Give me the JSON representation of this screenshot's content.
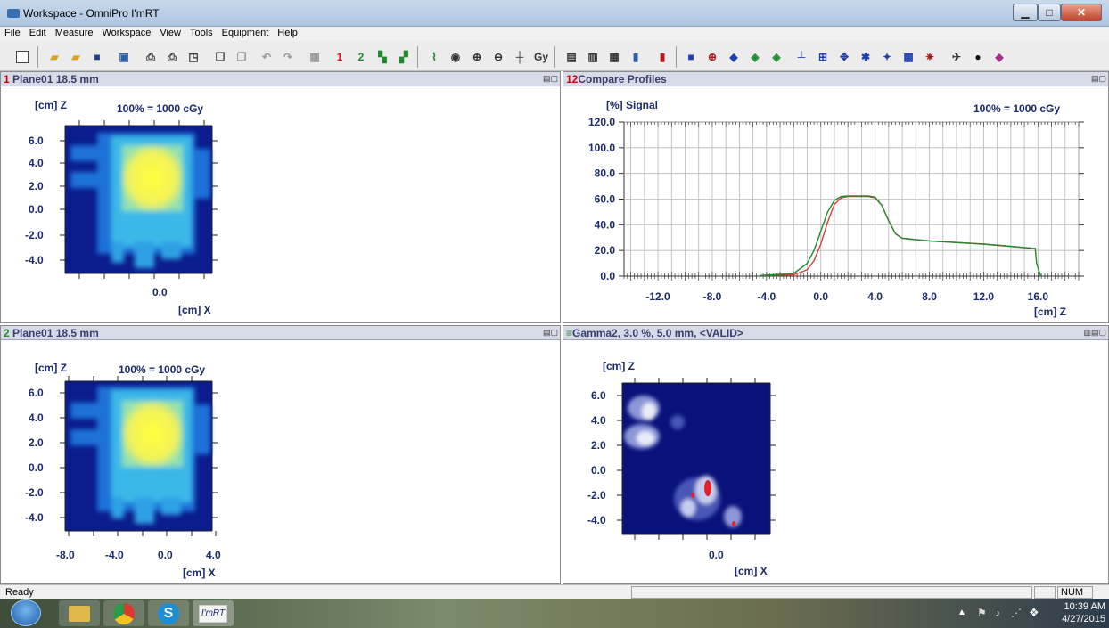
{
  "window": {
    "title": "Workspace - OmniPro I'mRT"
  },
  "menu": [
    "File",
    "Edit",
    "Measure",
    "Workspace",
    "View",
    "Tools",
    "Equipment",
    "Help"
  ],
  "toolbar": {
    "label_1": "1",
    "label_2": "2",
    "label_gy": "Gy"
  },
  "panels": {
    "plane1": {
      "num": "1",
      "title": "Plane01 18.5 mm",
      "z_unit": "[cm] Z",
      "dose_ref": "100% = 1000 cGy",
      "y_ticks": [
        "6.0",
        "4.0",
        "2.0",
        "0.0",
        "-2.0",
        "-4.0"
      ],
      "x_ticks": [
        "0.0"
      ],
      "x_unit": "[cm] X"
    },
    "profiles": {
      "num": "12",
      "title": "Compare Profiles",
      "y_label": "[%] Signal",
      "dose_ref": "100% = 1000 cGy",
      "x_unit": "[cm] Z"
    },
    "plane2": {
      "num": "2",
      "title": "Plane01 18.5 mm",
      "z_unit": "[cm] Z",
      "dose_ref": "100% = 1000 cGy",
      "y_ticks": [
        "6.0",
        "4.0",
        "2.0",
        "0.0",
        "-2.0",
        "-4.0"
      ],
      "x_ticks": [
        "-8.0",
        "-4.0",
        "0.0",
        "4.0"
      ],
      "x_unit": "[cm] X"
    },
    "gamma": {
      "title": "Gamma2,  3.0 %,  5.0 mm,  <VALID>",
      "z_unit": "[cm] Z",
      "y_ticks": [
        "6.0",
        "4.0",
        "2.0",
        "0.0",
        "-2.0",
        "-4.0"
      ],
      "x_ticks": [
        "0.0"
      ],
      "x_unit": "[cm] X"
    }
  },
  "chart_data": {
    "type": "line",
    "title": "",
    "xlabel": "[cm] Z",
    "ylabel": "[%] Signal",
    "xlim": [
      -14.5,
      19.0
    ],
    "ylim": [
      0,
      120
    ],
    "x_ticks": [
      "-12.0",
      "-8.0",
      "-4.0",
      "0.0",
      "4.0",
      "8.0",
      "12.0",
      "16.0"
    ],
    "y_ticks": [
      "120.0",
      "100.0",
      "80.0",
      "60.0",
      "40.0",
      "20.0",
      "0.0"
    ],
    "grid": true,
    "colors": {
      "series_1": "#e23b3b",
      "series_2": "#1f8a2e"
    },
    "series": [
      {
        "color": "#e23b3b",
        "x": [
          -4.5,
          -2.0,
          -1.0,
          -0.5,
          0.0,
          0.5,
          1.0,
          1.5,
          2.0,
          3.5,
          4.0,
          4.5,
          5.0,
          5.5,
          6.0,
          8.0,
          12.0,
          15.8
        ],
        "y": [
          0.5,
          1.0,
          5.0,
          12.0,
          25.0,
          42.0,
          56.0,
          61.0,
          62.0,
          62.0,
          61.0,
          55.0,
          43.0,
          33.0,
          29.5,
          27.5,
          25.0,
          21.5
        ]
      },
      {
        "color": "#1f8a2e",
        "x": [
          -4.5,
          -2.0,
          -1.0,
          -0.5,
          0.0,
          0.5,
          1.0,
          1.5,
          2.0,
          3.5,
          4.0,
          4.5,
          5.0,
          5.5,
          6.0,
          8.0,
          12.0,
          15.8,
          15.9,
          16.2
        ],
        "y": [
          0.5,
          2.0,
          10.0,
          20.0,
          35.0,
          50.0,
          59.0,
          62.0,
          62.5,
          62.5,
          61.5,
          55.0,
          43.0,
          33.0,
          29.5,
          27.5,
          25.0,
          21.5,
          10.0,
          0.0
        ]
      }
    ]
  },
  "colors": {
    "dose_low": "#0b1c8c",
    "dose_mid": "#2aa6e8",
    "dose_high": "#ffff3c",
    "gamma_bg": "#08127a",
    "gamma_fail": "#e8202a",
    "axis_label": "#1a2a6c"
  },
  "status": {
    "ready": "Ready",
    "num": "NUM"
  },
  "taskbar": {
    "imrt_label": "I'mRT",
    "time": "10:39 AM",
    "date": "4/27/2015"
  }
}
